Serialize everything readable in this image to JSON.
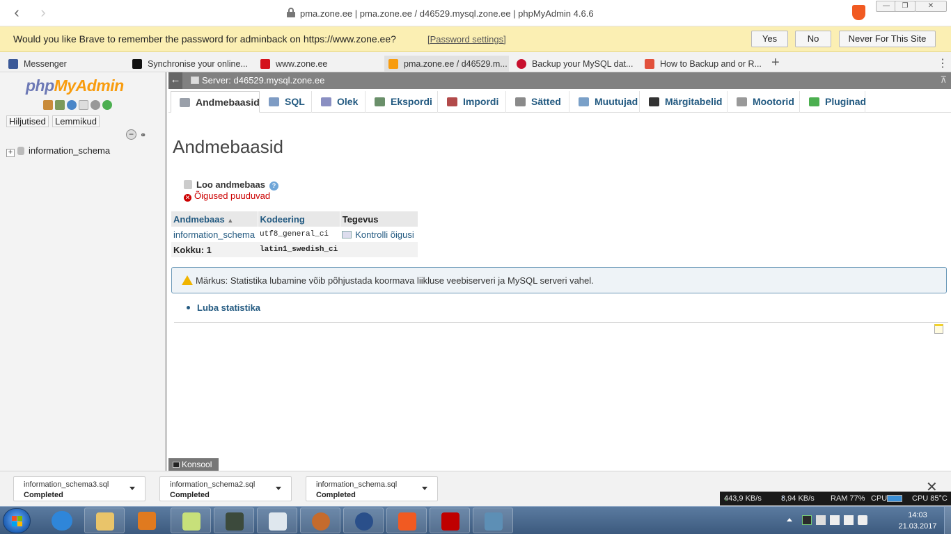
{
  "browser": {
    "url_text": "pma.zone.ee | pma.zone.ee / d46529.mysql.zone.ee | phpMyAdmin 4.6.6",
    "password_prompt": {
      "question": "Would you like Brave to remember the password for adminback on https://www.zone.ee?",
      "settings_link": "[Password settings]",
      "yes": "Yes",
      "no": "No",
      "never": "Never For This Site"
    },
    "tabs": [
      {
        "label": "Messenger",
        "icon": "facebook-icon",
        "color": "#3b5998"
      },
      {
        "label": "Synchronise your online...",
        "icon": "bigbuy-icon",
        "color": "#111111"
      },
      {
        "label": "www.zone.ee",
        "icon": "zone-icon",
        "color": "#d4121b"
      },
      {
        "label": "pma.zone.ee / d46529.m...",
        "icon": "phpmyadmin-icon",
        "color": "#f89c0e",
        "active": true
      },
      {
        "label": "Backup your MySQL dat...",
        "icon": "backup-icon",
        "color": "#c8102e"
      },
      {
        "label": "How to Backup and or R...",
        "icon": "howto-icon",
        "color": "#e2513c"
      }
    ]
  },
  "pma": {
    "logo_php": "php",
    "logo_myadmin": "MyAdmin",
    "recent": "Hiljutised",
    "favorites": "Lemmikud",
    "tree_db": "information_schema",
    "server": "Server: d46529.mysql.zone.ee",
    "menu": [
      {
        "label": "Andmebaasid",
        "icon": "database-icon",
        "color": "#9aa0aa"
      },
      {
        "label": "SQL",
        "icon": "sql-icon",
        "color": "#7e9cc4"
      },
      {
        "label": "Olek",
        "icon": "status-icon",
        "color": "#8a8fc2"
      },
      {
        "label": "Ekspordi",
        "icon": "export-icon",
        "color": "#6a8f6a"
      },
      {
        "label": "Impordi",
        "icon": "import-icon",
        "color": "#b24a4a"
      },
      {
        "label": "Sätted",
        "icon": "wrench-icon",
        "color": "#8a8a8a"
      },
      {
        "label": "Muutujad",
        "icon": "variables-icon",
        "color": "#7aa0c8"
      },
      {
        "label": "Märgitabelid",
        "icon": "charset-icon",
        "color": "#333333"
      },
      {
        "label": "Mootorid",
        "icon": "engine-icon",
        "color": "#999999"
      },
      {
        "label": "Pluginad",
        "icon": "plugin-icon",
        "color": "#4caf50"
      }
    ],
    "page_title": "Andmebaasid",
    "create_db": "Loo andmebaas",
    "no_privileges": "Õigused puuduvad",
    "table": {
      "headers": [
        "Andmebaas",
        "Kodeering",
        "Tegevus"
      ],
      "rows": [
        {
          "name": "information_schema",
          "collation": "utf8_general_ci",
          "action": "Kontrolli õigusi"
        }
      ],
      "footer": {
        "label": "Kokku: 1",
        "collation": "latin1_swedish_ci"
      }
    },
    "notice": "Märkus: Statistika lubamine võib põhjustada koormava liikluse veebiserveri ja MySQL serveri vahel.",
    "enable_stats": "Luba statistika",
    "console": "Konsool"
  },
  "downloads": [
    {
      "file": "information_schema3.sql",
      "status": "Completed"
    },
    {
      "file": "information_schema2.sql",
      "status": "Completed"
    },
    {
      "file": "information_schema.sql",
      "status": "Completed"
    }
  ],
  "meter": {
    "down": "443,9 KB/s",
    "up": "8,94 KB/s",
    "ram": "RAM 77%",
    "cpu_label": "CPU",
    "cpu_temp": "CPU 85°C"
  },
  "taskbar": {
    "time": "14:03",
    "date": "21.03.2017"
  }
}
